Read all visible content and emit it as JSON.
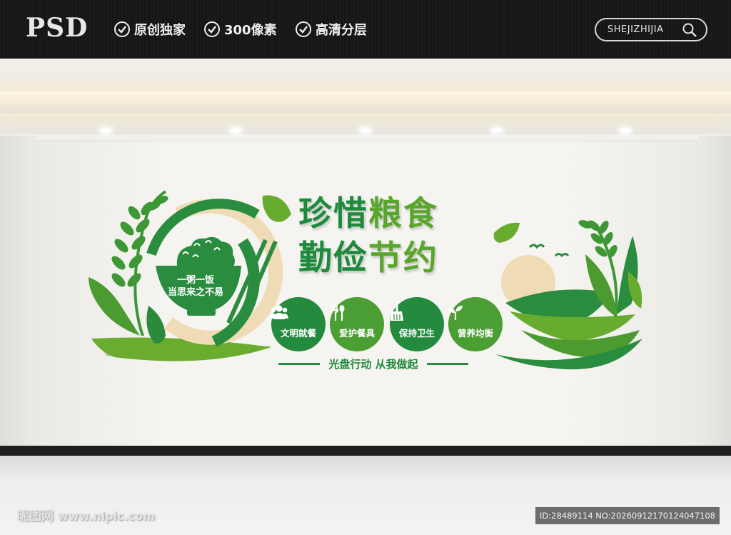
{
  "banner": {
    "logo": "PSD",
    "features": [
      "原创独家",
      "300像素",
      "高清分层"
    ],
    "search_text": "SHEJIZHIJIA"
  },
  "mural": {
    "title_line1": {
      "part_a": "珍惜",
      "part_b": "粮食"
    },
    "title_line2": {
      "part_a": "勤俭",
      "part_b": "节约"
    },
    "bowl_text": [
      "一粥一饭",
      "当思来之不易"
    ],
    "badges": [
      {
        "icon": "people-icon",
        "label": "文明就餐",
        "color": "#238a3e"
      },
      {
        "icon": "fork-spoon-icon",
        "label": "爱护餐具",
        "color": "#4a9e33"
      },
      {
        "icon": "broom-icon",
        "label": "保持卫生",
        "color": "#238a3e"
      },
      {
        "icon": "sprout-icon",
        "label": "营养均衡",
        "color": "#4a9e33"
      }
    ],
    "slogan": "光盘行动 从我做起",
    "colors": {
      "dark_green": "#1d8a3c",
      "light_green": "#5aa62d",
      "beige": "#efdcb6"
    }
  },
  "watermark": {
    "site_cn": "昵图网",
    "site_url": "www.nipic.com",
    "id_text": "ID:28489114 NO:20260912170124047108"
  }
}
